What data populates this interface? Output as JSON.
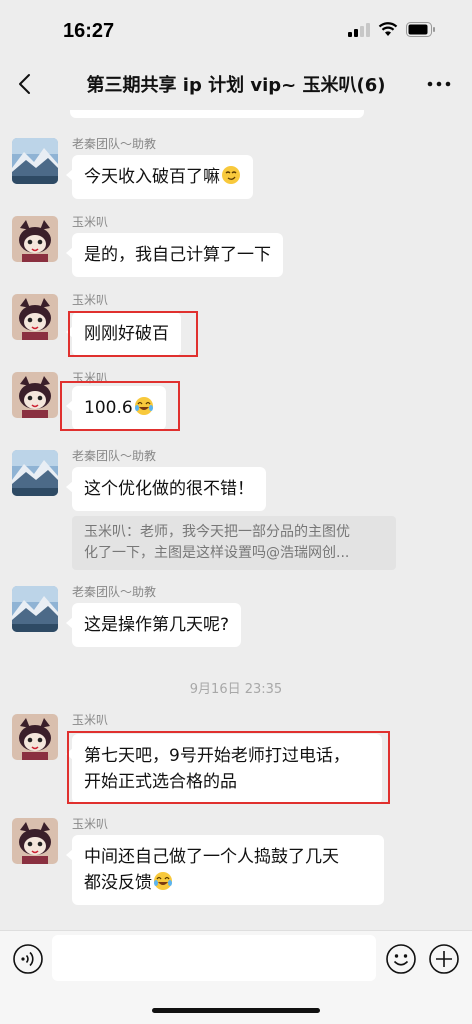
{
  "status_bar": {
    "time": "16:27"
  },
  "header": {
    "title": "第三期共享 ip 计划 vip~ 玉米叭(6)"
  },
  "messages": [
    {
      "sender": "老秦团队～助教",
      "text": "今天收入破百了嘛",
      "emoji": "smirk-emoji"
    },
    {
      "sender": "玉米叭",
      "text": "是的，我自己计算了一下"
    },
    {
      "sender": "玉米叭",
      "text": "刚刚好破百",
      "highlighted": true
    },
    {
      "sender": "玉米叭",
      "text": "100.6",
      "emoji": "cry-laugh-emoji",
      "highlighted": true
    },
    {
      "sender": "老秦团队～助教",
      "text": "这个优化做的很不错！",
      "quote_line1": "玉米叭：老师，我今天把一部分品的主图优",
      "quote_line2": "化了一下，主图是这样设置吗@浩瑞网创..."
    },
    {
      "sender": "老秦团队～助教",
      "text": "这是操作第几天呢?"
    },
    {
      "sender": "玉米叭",
      "line1": "第七天吧，9号开始老师打过电话，",
      "line2": "开始正式选合格的品",
      "highlighted": true
    },
    {
      "sender": "玉米叭",
      "line1": "中间还自己做了一个人捣鼓了几天",
      "line2": "都没反馈",
      "emoji": "cry-laugh-emoji"
    }
  ],
  "timestamp": "9月16日 23:35",
  "input": {
    "placeholder": ""
  },
  "colors": {
    "highlight": "#e0302e",
    "bubble": "#ffffff",
    "background": "#ededed"
  }
}
